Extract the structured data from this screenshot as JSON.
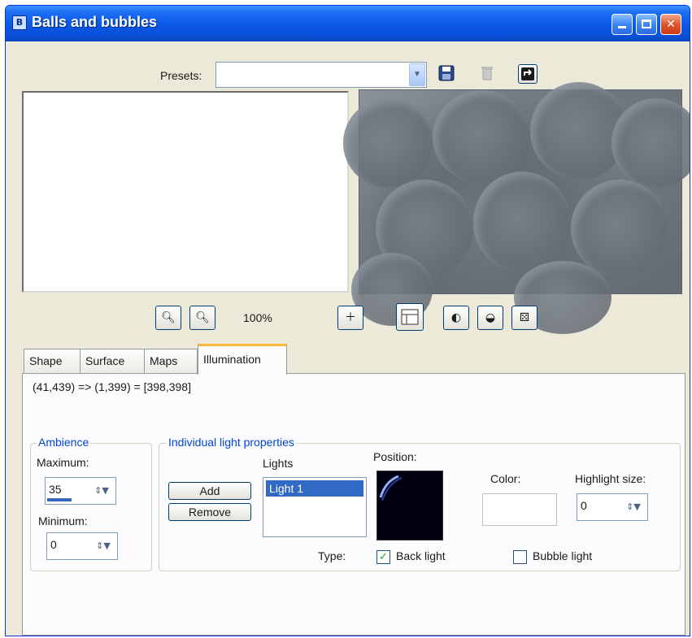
{
  "window": {
    "title": "Balls and bubbles",
    "title_icon": "B",
    "controls": [
      "minimize",
      "maximize",
      "close"
    ]
  },
  "presets": {
    "label": "Presets:",
    "value": "",
    "icons": [
      "save-icon",
      "delete-icon",
      "reset-icon"
    ]
  },
  "zoom": {
    "level": "100%",
    "zoom_in_icon": "zoom-in-icon",
    "zoom_out_icon": "zoom-out-icon"
  },
  "tabs": [
    {
      "label": "Shape",
      "active": false
    },
    {
      "label": "Surface",
      "active": false
    },
    {
      "label": "Maps",
      "active": false
    },
    {
      "label": "Illumination",
      "active": true
    }
  ],
  "illumination": {
    "coords": "(41,439) => (1,399) = [398,398]",
    "ambience": {
      "legend": "Ambience",
      "maximum_label": "Maximum:",
      "maximum_value": "35",
      "minimum_label": "Minimum:",
      "minimum_value": "0"
    },
    "individual": {
      "legend": "Individual light properties",
      "lights_label": "Lights",
      "add_label": "Add",
      "remove_label": "Remove",
      "lights": [
        "Light 1"
      ],
      "selected_light": "Light 1",
      "position_label": "Position:",
      "color_label": "Color:",
      "color_value": "#ffffff",
      "highlight_label": "Highlight size:",
      "highlight_value": "0",
      "type_label": "Type:",
      "back_light_label": "Back light",
      "back_light_checked": true,
      "bubble_light_label": "Bubble light",
      "bubble_light_checked": false
    }
  },
  "colors": {
    "titlebar": "#0a58e6",
    "selection": "#316ac5",
    "group_legend": "#0046d5",
    "active_tab_accent": "#f6b73e"
  }
}
